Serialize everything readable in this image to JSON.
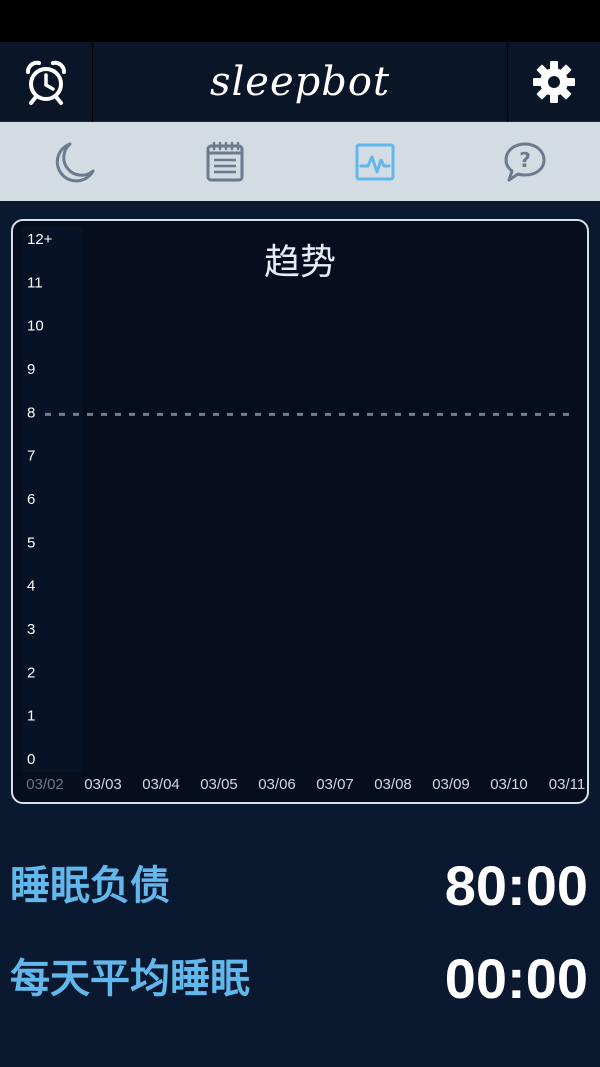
{
  "header": {
    "logo_text": "sleepbot",
    "left_icon": "alarm-clock-icon",
    "right_icon": "gear-icon"
  },
  "tabs": [
    {
      "icon": "moon-icon",
      "active": false
    },
    {
      "icon": "notepad-icon",
      "active": false
    },
    {
      "icon": "activity-chart-icon",
      "active": true
    },
    {
      "icon": "help-bubble-icon",
      "active": false
    }
  ],
  "colors": {
    "accent": "#62b8ec",
    "tab_inactive": "#6b7a8c",
    "background": "#0b1930",
    "chart_bg": "#050d1f"
  },
  "chart": {
    "title": "趋势"
  },
  "chart_data": {
    "type": "line",
    "title": "趋势",
    "categories": [
      "03/02",
      "03/03",
      "03/04",
      "03/05",
      "03/06",
      "03/07",
      "03/08",
      "03/09",
      "03/10",
      "03/11"
    ],
    "y_ticks": [
      "0",
      "1",
      "2",
      "3",
      "4",
      "5",
      "6",
      "7",
      "8",
      "9",
      "10",
      "11",
      "12+"
    ],
    "ylim": [
      0,
      12
    ],
    "target_line": 8,
    "series": [],
    "grid": false
  },
  "stats": {
    "sleep_debt_label": "睡眠负债",
    "sleep_debt_value": "80:00",
    "avg_sleep_label": "每天平均睡眠",
    "avg_sleep_value": "00:00"
  }
}
